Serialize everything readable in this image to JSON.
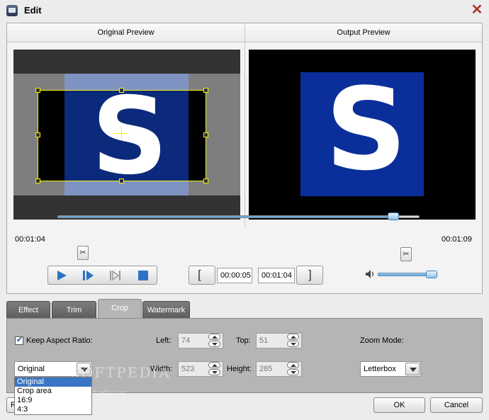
{
  "window": {
    "title": "Edit"
  },
  "preview": {
    "original_label": "Original Preview",
    "output_label": "Output Preview",
    "glyph": "S"
  },
  "timeline": {
    "start_time": "00:01:04",
    "end_time": "00:01:09",
    "progress_fraction": 0.93
  },
  "trim": {
    "start_value": "00:00:05",
    "end_value": "00:01:04"
  },
  "volume": {
    "level_fraction": 0.85
  },
  "tabs": [
    "Effect",
    "Trim",
    "Crop",
    "Watermark"
  ],
  "active_tab": "Crop",
  "crop": {
    "keep_aspect_label": "Keep Aspect Ratio:",
    "left_label": "Left:",
    "left_value": "74",
    "top_label": "Top:",
    "top_value": "51",
    "width_label": "Width:",
    "width_value": "523",
    "height_label": "Height:",
    "height_value": "285",
    "zoom_label": "Zoom Mode:",
    "zoom_value": "Letterbox",
    "aspect_value": "Original",
    "aspect_options": [
      "Original",
      "Crop area",
      "16:9",
      "4:3"
    ]
  },
  "watermark_text": "SOFTPEDIA",
  "watermark_sub": "www.softpedia.com",
  "buttons": {
    "partial_label": "R",
    "ok": "OK",
    "cancel": "Cancel"
  },
  "colors": {
    "accent": "#3a75c4",
    "video_blue": "#0a2f9a",
    "crop_frame": "#f7f200"
  }
}
